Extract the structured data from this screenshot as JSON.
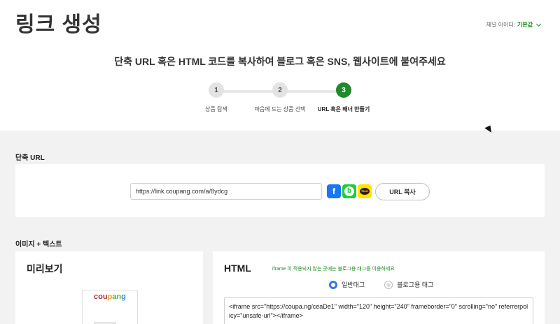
{
  "header": {
    "title": "링크 생성",
    "channel_label": "채널 아이디:",
    "channel_value": "기본값"
  },
  "subtitle": "단축 URL 혹은 HTML 코드를 복사하여 블로그 혹은 SNS, 웹사이트에 붙여주세요",
  "steps": [
    {
      "number": "1",
      "label": "상품 탐색",
      "active": false
    },
    {
      "number": "2",
      "label": "마음에 드는 상품 선택",
      "active": false
    },
    {
      "number": "3",
      "label": "URL 혹은 배너 만들기",
      "active": true
    }
  ],
  "short_url": {
    "section_label": "단축 URL",
    "url": "https://link.coupang.com/a/8ydcg",
    "copy_label": "URL 복사",
    "share_icons": [
      "facebook-icon",
      "band-icon",
      "kakaotalk-icon"
    ]
  },
  "image_text": {
    "section_label": "이미지 + 텍스트",
    "preview_title": "미리보기",
    "banner_logo": [
      "cou",
      "p",
      "an",
      "g"
    ],
    "html_title": "HTML",
    "html_note": "iframe 이 적용되지 않는 곳에는 블로그용 태그를 이용하세요",
    "radio_normal": "일반태그",
    "radio_blog": "블로그용 태그",
    "code": "<iframe src=\"https://coupa.ng/ceaDe1\" width=\"120\" height=\"240\" frameborder=\"0\" scrolling=\"no\" referrerpolicy=\"unsafe-url\"></iframe>"
  },
  "colors": {
    "accent_green": "#1f8a2c",
    "radio_blue": "#3c74e8",
    "facebook": "#1877f2",
    "band": "#1ecb3a",
    "kakao": "#fee500"
  }
}
